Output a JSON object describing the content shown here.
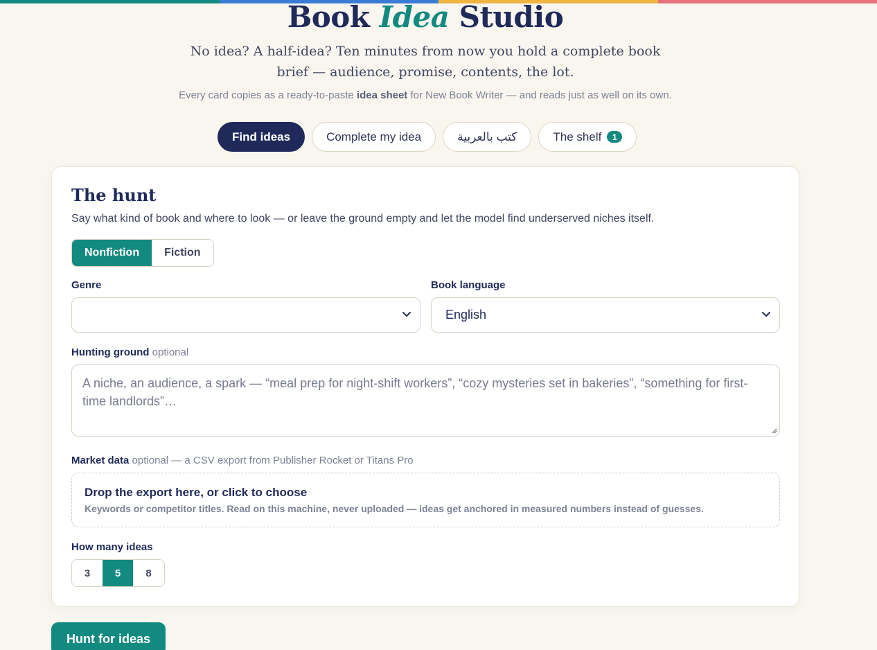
{
  "brand_colors": [
    "#128a80",
    "#3a7bd5",
    "#f2b441",
    "#e8707a"
  ],
  "header": {
    "title_pre": "Book",
    "title_accent": "Idea",
    "title_post": "Studio",
    "tagline": "No idea? A half-idea? Ten minutes from now you hold a complete book brief — audience, promise, contents, the lot.",
    "subline_pre": "Every card copies as a ready-to-paste",
    "subline_bold": "idea sheet",
    "subline_post": "for New Book Writer — and reads just as well on its own."
  },
  "tabs": [
    {
      "label": "Find ideas",
      "active": true
    },
    {
      "label": "Complete my idea"
    },
    {
      "label": "كتب بالعربية"
    },
    {
      "label": "The shelf",
      "badge": "1"
    }
  ],
  "hunt": {
    "title": "The hunt",
    "subtitle": "Say what kind of book and where to look — or leave the ground empty and let the model find underserved niches itself.",
    "kind_options": [
      "Nonfiction",
      "Fiction"
    ],
    "kind_selected": "Nonfiction",
    "genre_label": "Genre",
    "genre_value": "",
    "language_label": "Book language",
    "language_value": "English",
    "ground_label": "Hunting ground",
    "ground_optional": "optional",
    "ground_placeholder": "A niche, an audience, a spark — “meal prep for night-shift workers”, “cozy mysteries set in bakeries”, “something for first-time landlords”…",
    "market_label": "Market data",
    "market_optional": "optional — a CSV export from Publisher Rocket or Titans Pro",
    "drop_title": "Drop the export here, or click to choose",
    "drop_sub": "Keywords or competitor titles. Read on this machine, never uploaded — ideas get anchored in measured numbers instead of guesses.",
    "count_label": "How many ideas",
    "count_options": [
      "3",
      "5",
      "8"
    ],
    "count_selected": "5"
  },
  "cta": {
    "label": "Hunt for ideas"
  }
}
